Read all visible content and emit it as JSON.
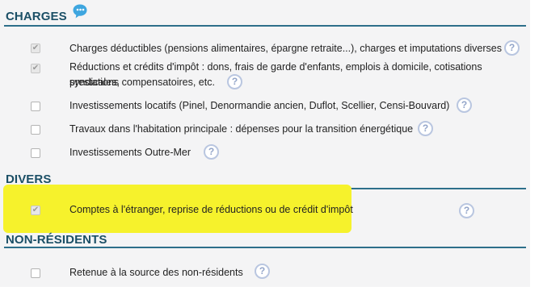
{
  "sections": {
    "charges": {
      "title": "CHARGES"
    },
    "divers": {
      "title": "DIVERS"
    },
    "non_residents": {
      "title": "NON-RÉSIDENTS"
    }
  },
  "charges_items": [
    {
      "label": "Charges déductibles (pensions alimentaires, épargne retraite...), charges et imputations diverses",
      "checked": true,
      "disabled": true
    },
    {
      "label_line1": "Réductions et crédits d'impôt : dons, frais de garde d'enfants, emplois à domicile, cotisations syndicales,",
      "label_line2": "prestations compensatoires, etc.",
      "checked": true,
      "disabled": true
    },
    {
      "label": "Investissements locatifs (Pinel, Denormandie ancien, Duflot, Scellier, Censi-Bouvard)",
      "checked": false
    },
    {
      "label": "Travaux dans l'habitation principale : dépenses pour la transition énergétique",
      "checked": false
    },
    {
      "label": "Investissements Outre-Mer",
      "checked": false
    }
  ],
  "divers_items": [
    {
      "label": "Comptes à l'étranger, reprise de réductions ou de crédit d'impôt",
      "checked": true,
      "disabled": true,
      "highlighted": true
    }
  ],
  "non_residents_items": [
    {
      "label": "Retenue à la source des non-résidents",
      "checked": false
    }
  ],
  "help_icon_glyph": "?",
  "checkmark_glyph": "✔",
  "colors": {
    "section_title": "#1b4f66",
    "section_rule": "#2d6f8a",
    "panel_bg": "#f4f4f5",
    "highlight": "#f6f22c",
    "help_icon": "#93a5c9",
    "speech_bubble": "#3ea6df"
  },
  "icons": {
    "header_bubble": "speech-bubble-icon",
    "help": "help-circle-icon",
    "checkbox": "checkbox"
  }
}
